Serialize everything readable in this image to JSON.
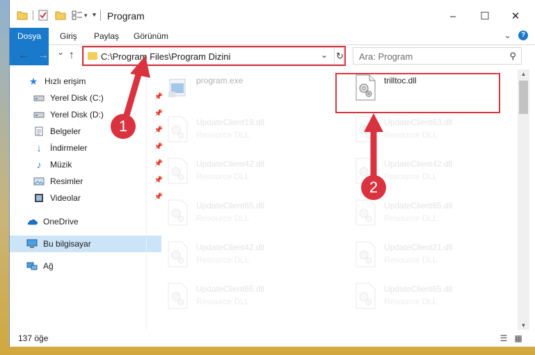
{
  "window": {
    "title": "Program",
    "controls": {
      "minimize": "–",
      "maximize": "☐",
      "close": "✕"
    }
  },
  "ribbon": {
    "tabs": [
      {
        "label": "Dosya",
        "active": true
      },
      {
        "label": "Giriş"
      },
      {
        "label": "Paylaş"
      },
      {
        "label": "Görünüm"
      }
    ],
    "expand_icon": "chevron-down-icon",
    "help_icon": "?"
  },
  "address": {
    "path": "C:\\Program Files\\Program Dizini",
    "nav": {
      "back": "←",
      "forward": "→",
      "recent": "⌄",
      "up": "↑"
    }
  },
  "search": {
    "placeholder": "Ara: Program"
  },
  "nav_pane": {
    "items": [
      {
        "label": "Hızlı erişim",
        "icon": "star-icon",
        "pinned": false
      },
      {
        "label": "Yerel Disk (C:)",
        "icon": "drive-icon",
        "pinned": true
      },
      {
        "label": "Yerel Disk (D:)",
        "icon": "drive-icon",
        "pinned": true
      },
      {
        "label": "Belgeler",
        "icon": "documents-icon",
        "pinned": true
      },
      {
        "label": "İndirmeler",
        "icon": "download-icon",
        "pinned": true
      },
      {
        "label": "Müzik",
        "icon": "music-icon",
        "pinned": true
      },
      {
        "label": "Resimler",
        "icon": "pictures-icon",
        "pinned": true
      },
      {
        "label": "Videolar",
        "icon": "videos-icon",
        "pinned": true
      },
      {
        "label": "OneDrive",
        "icon": "cloud-icon",
        "pinned": false
      },
      {
        "label": "Bu bilgisayar",
        "icon": "computer-icon",
        "pinned": false,
        "selected": true
      },
      {
        "label": "Ağ",
        "icon": "network-icon",
        "pinned": false
      }
    ]
  },
  "files": [
    {
      "name": "program.exe",
      "desc": "",
      "kind": "exe",
      "state": "dim"
    },
    {
      "name": "trilltoc.dll",
      "desc": "",
      "kind": "dll",
      "state": "normal"
    },
    {
      "name": "UpdateClient19.dll",
      "desc": "Resource DLL",
      "kind": "dll",
      "state": "faded"
    },
    {
      "name": "UpdateClient63.dll",
      "desc": "Resource DLL",
      "kind": "dll",
      "state": "faded"
    },
    {
      "name": "UpdateClient42.dll",
      "desc": "Resource DLL",
      "kind": "dll",
      "state": "faded"
    },
    {
      "name": "UpdateClient42.dll",
      "desc": "Resource DLL",
      "kind": "dll",
      "state": "faded"
    },
    {
      "name": "UpdateClient65.dll",
      "desc": "Resource DLL",
      "kind": "dll",
      "state": "faded"
    },
    {
      "name": "UpdateClient65.dll",
      "desc": "Resource DLL",
      "kind": "dll",
      "state": "faded"
    },
    {
      "name": "UpdateClient42.dll",
      "desc": "Resource DLL",
      "kind": "dll",
      "state": "faded"
    },
    {
      "name": "UpdateClient21.dll",
      "desc": "Resource DLL",
      "kind": "dll",
      "state": "faded"
    },
    {
      "name": "UpdateClient65.dll",
      "desc": "Resource DLL",
      "kind": "dll",
      "state": "faded"
    },
    {
      "name": "UpdateClient65.dll",
      "desc": "Resource DLL",
      "kind": "dll",
      "state": "faded"
    }
  ],
  "status": {
    "count": "137 öğe"
  },
  "annotations": {
    "step1": "1",
    "step2": "2",
    "color": "#d9333f"
  }
}
